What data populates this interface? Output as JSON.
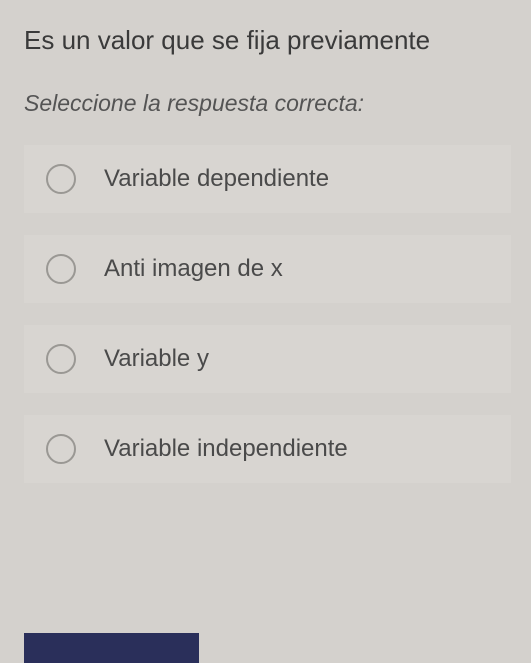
{
  "question": {
    "text": "Es un valor que se fija previamente",
    "instruction": "Seleccione la respuesta correcta:"
  },
  "options": [
    {
      "label": "Variable dependiente"
    },
    {
      "label": "Anti imagen de x"
    },
    {
      "label": "Variable y"
    },
    {
      "label": "Variable independiente"
    }
  ]
}
